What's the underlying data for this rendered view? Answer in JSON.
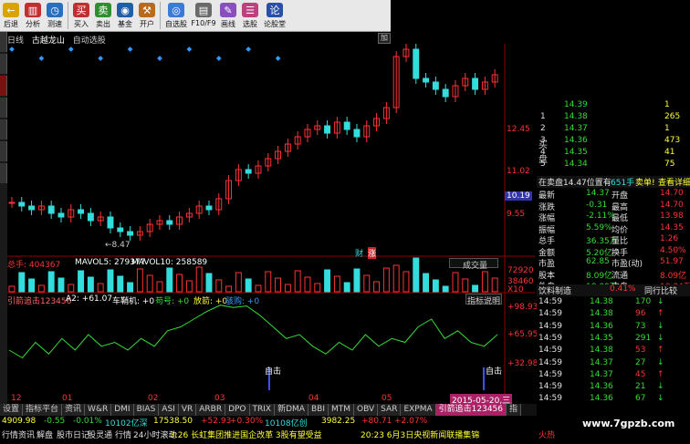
{
  "toolbar": {
    "buttons": [
      {
        "label": "后退",
        "icon": "back-arrow-icon"
      },
      {
        "label": "分析",
        "icon": "chart-icon"
      },
      {
        "label": "测速",
        "icon": "speed-icon"
      },
      {
        "label": "买入",
        "icon": "buy-icon"
      },
      {
        "label": "卖出",
        "icon": "sell-icon"
      },
      {
        "label": "基金",
        "icon": "fund-icon"
      },
      {
        "label": "开户",
        "icon": "account-icon"
      },
      {
        "label": "自选股",
        "icon": "watchlist-icon"
      },
      {
        "label": "F10/F9",
        "icon": "f10-icon"
      },
      {
        "label": "画线",
        "icon": "draw-line-icon"
      },
      {
        "label": "选股",
        "icon": "select-stock-icon"
      },
      {
        "label": "论股堂",
        "icon": "forum-icon"
      }
    ]
  },
  "header": {
    "items": [
      "日线",
      "古越龙山",
      "自动选股"
    ],
    "add_button": "加"
  },
  "chart": {
    "price_labels": [
      "12.45",
      "11.02",
      "10.19",
      "9.55"
    ],
    "low_marker": "8.47",
    "tags": [
      "财",
      "涨"
    ],
    "volume_header": {
      "total": "总手: 404367",
      "mavol5": "MAVOL5: 279377",
      "mavol10": "MAVOL10: 258589",
      "dropdown": "成交量"
    },
    "volume_labels": [
      "72920",
      "38460",
      "X10"
    ],
    "indicator_header": {
      "name": "引箭追击123456",
      "a2": "A2: +61.07",
      "cheli": "车鞘机: +0",
      "gouhao": "苟号: +0",
      "fangjian": "放箭: +0",
      "jieling": "骇购: +0",
      "explain_button": "指标说明"
    },
    "indicator_labels": [
      "+98.93",
      "+65.95",
      "+32.98"
    ],
    "signal_label": "自击",
    "x_ticks": [
      "12",
      "01",
      "02",
      "03",
      "04",
      "05"
    ],
    "date_badge": "2015-05-20,三"
  },
  "chart_data": {
    "type": "line",
    "title": "",
    "xlabel": "",
    "ylabel": "",
    "ylim": [
      8.0,
      13.5
    ],
    "candles_close": [
      9.4,
      9.3,
      9.2,
      9.3,
      9.1,
      9.0,
      9.2,
      9.1,
      8.9,
      9.0,
      8.7,
      8.6,
      8.5,
      8.6,
      8.8,
      8.9,
      8.8,
      9.0,
      9.1,
      9.3,
      9.2,
      9.5,
      10.0,
      10.3,
      10.2,
      10.4,
      10.6,
      10.8,
      11.0,
      11.2,
      11.4,
      11.5,
      11.3,
      11.6,
      11.4,
      11.2,
      11.5,
      11.7,
      12.0,
      13.4,
      13.6,
      12.8,
      12.7,
      12.5,
      12.3,
      12.6,
      12.8,
      12.5,
      12.7,
      12.9
    ],
    "indicator_line": [
      40,
      30,
      50,
      35,
      55,
      40,
      60,
      45,
      50,
      40,
      55,
      45,
      65,
      70,
      80,
      90,
      98,
      95,
      97,
      85,
      70,
      55,
      60,
      45,
      35,
      50,
      40,
      60,
      45,
      55,
      50,
      70,
      80,
      55,
      65,
      50,
      45,
      60
    ]
  },
  "tabs": [
    "设置",
    "指标平台",
    "资讯",
    "W&R",
    "DMI",
    "BIAS",
    "ASI",
    "VR",
    "ARBR",
    "DPO",
    "TRIX",
    "新DMA",
    "BBI",
    "MTM",
    "OBV",
    "SAR",
    "EXPMA",
    "引箭追击123456",
    "指"
  ],
  "right_panel": {
    "bid_label": "买\n盘",
    "bids": [
      {
        "n": "",
        "price": "14.39",
        "vol": "1"
      },
      {
        "n": "1",
        "price": "14.38",
        "vol": "265"
      },
      {
        "n": "2",
        "price": "14.37",
        "vol": "1"
      },
      {
        "n": "3",
        "price": "14.36",
        "vol": "473"
      },
      {
        "n": "4",
        "price": "14.35",
        "vol": "41"
      },
      {
        "n": "5",
        "price": "14.34",
        "vol": "75"
      }
    ],
    "order_line": {
      "text": "在卖盘14.47位置有",
      "count": "651手",
      "action": "卖单!",
      "link": "查看详细"
    },
    "stats": [
      {
        "l": "最新",
        "v": "14.37",
        "l2": "开盘",
        "v2": "14.70"
      },
      {
        "l": "涨跌",
        "v": "-0.31",
        "l2": "最高",
        "v2": "14.70"
      },
      {
        "l": "涨幅",
        "v": "-2.11%",
        "l2": "最低",
        "v2": "13.98"
      },
      {
        "l": "振幅",
        "v": "5.59%",
        "l2": "均价",
        "v2": "14.35"
      },
      {
        "l": "总手",
        "v": "36.35万",
        "l2": "量比",
        "v2": "1.26"
      },
      {
        "l": "金额",
        "v": "5.20亿",
        "l2": "换手",
        "v2": "4.50%"
      },
      {
        "l": "市盈",
        "v": "62.85",
        "l2": "市盈(动)",
        "v2": "51.97"
      },
      {
        "l": "股本",
        "v": "8.09亿",
        "l2": "流通",
        "v2": "8.09亿"
      },
      {
        "l": "外盘",
        "v": "18.00万",
        "l2": "内盘",
        "v2": "18.34万"
      }
    ],
    "sub_tabs": {
      "left": "饮料制造",
      "mid": "0.41%",
      "right": "同行比较"
    },
    "ticks": [
      {
        "t": "14:59",
        "p": "14.38",
        "v": "170",
        "d": "down"
      },
      {
        "t": "14:59",
        "p": "14.38",
        "v": "96",
        "d": "up"
      },
      {
        "t": "14:59",
        "p": "14.36",
        "v": "73",
        "d": "down"
      },
      {
        "t": "14:59",
        "p": "14.35",
        "v": "291",
        "d": "down"
      },
      {
        "t": "14:59",
        "p": "14.38",
        "v": "53",
        "d": "up"
      },
      {
        "t": "14:59",
        "p": "14.37",
        "v": "27",
        "d": "down"
      },
      {
        "t": "14:59",
        "p": "14.37",
        "v": "45",
        "d": "up"
      },
      {
        "t": "14:59",
        "p": "14.36",
        "v": "21",
        "d": "down"
      },
      {
        "t": "14:59",
        "p": "14.36",
        "v": "67",
        "d": "down"
      }
    ]
  },
  "status": {
    "row1": [
      {
        "t": "4909.98",
        "c": "yel"
      },
      {
        "t": "-0.55",
        "c": "grn"
      },
      {
        "t": "-0.01%",
        "c": "grn"
      },
      {
        "t": "10102亿深",
        "c": "cy"
      },
      {
        "t": "17538.50",
        "c": "yel"
      },
      {
        "t": "+52.93",
        "c": "red"
      },
      {
        "t": "+0.30%",
        "c": "red"
      },
      {
        "t": "10108亿创",
        "c": "cy"
      },
      {
        "t": "3982.25",
        "c": "yel"
      },
      {
        "t": "+80.71",
        "c": "red"
      },
      {
        "t": "+2.07%",
        "c": "red"
      }
    ],
    "row2": [
      {
        "t": "行情",
        "c": "wht"
      },
      {
        "t": "资讯",
        "c": "wht"
      },
      {
        "t": "解盘",
        "c": "wht"
      },
      {
        "t": "股市日记",
        "c": "wht"
      },
      {
        "t": "股灵通",
        "c": "wht"
      },
      {
        "t": "行情",
        "c": "wht"
      },
      {
        "t": "24小时滚动",
        "c": "wht"
      },
      {
        "t": "3:26 长虹集团推进国企改革 3股有望受益",
        "c": "yel"
      },
      {
        "t": "20:23 6月3日央视新闻联播集锦",
        "c": "yel"
      },
      {
        "t": "火热",
        "c": "red"
      }
    ]
  },
  "watermark": "www.7gpzb.com"
}
